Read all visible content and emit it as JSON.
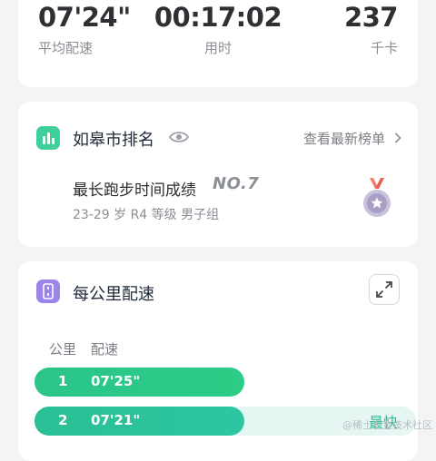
{
  "stats": {
    "pace": {
      "value": "07'24\"",
      "label": "平均配速"
    },
    "time": {
      "value": "00:17:02",
      "label": "用时"
    },
    "calories": {
      "value": "237",
      "label": "千卡"
    }
  },
  "ranking": {
    "title": "如皋市排名",
    "link": "查看最新榜单",
    "best_title": "最长跑步时间成绩",
    "best_rank": "NO.7",
    "best_sub": "23-29 岁 R4 等级 男子组",
    "icons": [
      "bar-chart-icon",
      "eye-icon",
      "chevron-right-icon",
      "medal-icon"
    ]
  },
  "pace_section": {
    "title": "每公里配速",
    "col_km": "公里",
    "col_pace": "配速",
    "rows": [
      {
        "km": "1",
        "pace": "07'25\"",
        "fill": 0.55
      },
      {
        "km": "2",
        "pace": "07'21\"",
        "fill": 0.55,
        "tag": "最快"
      }
    ],
    "icons": [
      "list-icon",
      "expand-icon"
    ]
  },
  "colors": {
    "accent_green": "#2bc48a",
    "accent_teal": "#2bbf94",
    "accent_purple": "#9b84ea"
  },
  "watermark": "@稀土掘金技术社区"
}
